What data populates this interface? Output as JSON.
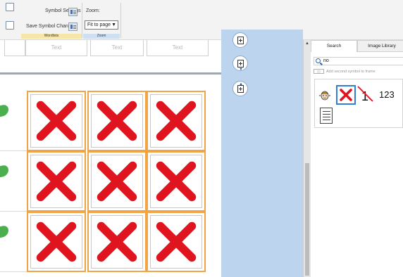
{
  "ribbon": {
    "symbol_settings_label": "Symbol Settings",
    "save_symbol_changes_label": "Save Symbol Changes",
    "zoom_label": "Zoom:",
    "zoom_value": "Fit to page",
    "group_wordlists": "Wordlists",
    "group_zoom": "Zoom"
  },
  "grid": {
    "top_cells": [
      "Text",
      "Text",
      "Text"
    ],
    "cell_symbol": "red-cross-icon",
    "rows": 3,
    "cols": 3
  },
  "panel": {
    "tabs": [
      "Search",
      "Image Library"
    ],
    "search_value": "no",
    "add_second_label": "Add second symbol to frame",
    "results_text": "123"
  },
  "colors": {
    "cross_red": "#e0141e",
    "cell_border": "#f0a445",
    "green_marker": "#4caf4f",
    "middle_panel": "#bdd4ee",
    "selection_blue": "#2f7fd6"
  }
}
